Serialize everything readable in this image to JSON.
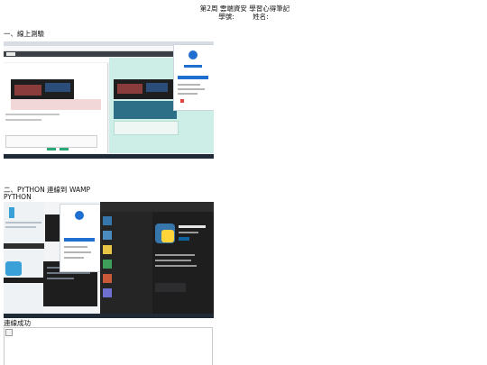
{
  "header": {
    "title": "第2周 雲端資安 學習心得筆記",
    "student_id_label": "學號:",
    "name_label": "姓名:"
  },
  "sections": [
    {
      "heading": "一、線上測驗"
    },
    {
      "heading": "二、PYTHON 連線到 WAMP",
      "sub": "PYTHON"
    }
  ],
  "caption": "連線成功",
  "screenshots": [
    {
      "name": "online-quiz-screenshot"
    },
    {
      "name": "python-vscode-screenshot"
    },
    {
      "name": "wamp-connection-screenshot"
    }
  ],
  "colors": {
    "accent": "#1f6fd1",
    "dark": "#1e1e1e",
    "mint": "#cdeee6"
  }
}
